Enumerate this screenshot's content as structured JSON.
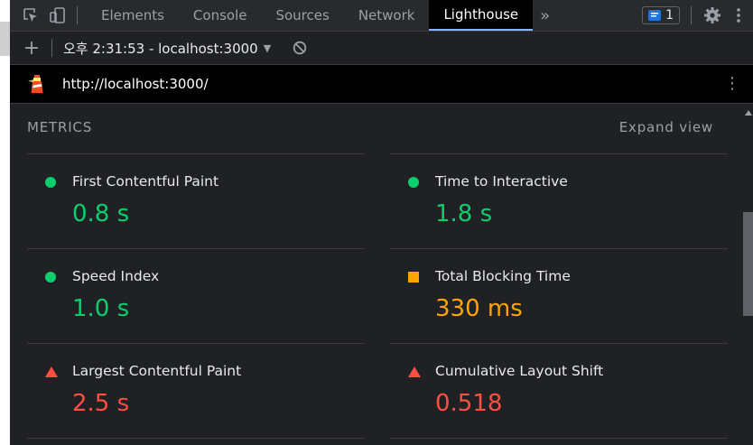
{
  "tabs": [
    {
      "label": "Elements",
      "active": false
    },
    {
      "label": "Console",
      "active": false
    },
    {
      "label": "Sources",
      "active": false
    },
    {
      "label": "Network",
      "active": false
    },
    {
      "label": "Lighthouse",
      "active": true
    }
  ],
  "more_tabs_icon": "»",
  "issues_count": "1",
  "toolbar": {
    "plus": "+",
    "report_label": "오후 2:31:53 - localhost:3000",
    "caret": "▼"
  },
  "urlbar": {
    "url": "http://localhost:3000/",
    "kebab": "⋮"
  },
  "metrics": {
    "title": "METRICS",
    "expand_label": "Expand view",
    "items": [
      {
        "label": "First Contentful Paint",
        "value": "0.8 s",
        "status": "pass"
      },
      {
        "label": "Time to Interactive",
        "value": "1.8 s",
        "status": "pass"
      },
      {
        "label": "Speed Index",
        "value": "1.0 s",
        "status": "pass"
      },
      {
        "label": "Total Blocking Time",
        "value": "330 ms",
        "status": "average"
      },
      {
        "label": "Largest Contentful Paint",
        "value": "2.5 s",
        "status": "fail"
      },
      {
        "label": "Cumulative Layout Shift",
        "value": "0.518",
        "status": "fail"
      }
    ]
  },
  "colors": {
    "pass": "#0cce6b",
    "average": "#ffa400",
    "fail": "#ff4e42",
    "accent": "#8ab4f8"
  },
  "icons": [
    "inspect-icon",
    "device-toggle-icon",
    "issues-icon",
    "gear-icon",
    "kebab-icon",
    "clear-icon",
    "lighthouse-logo"
  ]
}
